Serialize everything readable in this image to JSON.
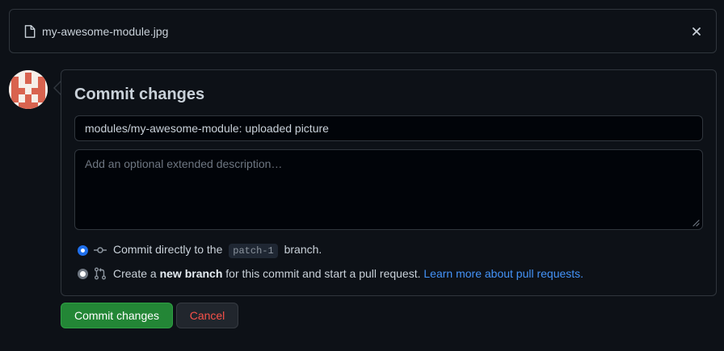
{
  "file": {
    "name": "my-awesome-module.jpg",
    "icon": "file-icon"
  },
  "commit": {
    "title": "Commit changes",
    "summary_value": "modules/my-awesome-module: uploaded picture",
    "description_placeholder": "Add an optional extended description…",
    "options": [
      {
        "icon": "git-commit-icon",
        "prefix": "Commit directly to the",
        "branch": "patch-1",
        "suffix": "branch.",
        "checked": true
      },
      {
        "icon": "git-pull-request-icon",
        "prefix": "Create a",
        "bold": "new branch",
        "suffix": "for this commit and start a pull request.",
        "link": "Learn more about pull requests.",
        "checked": false
      }
    ]
  },
  "buttons": {
    "commit_label": "Commit changes",
    "cancel_label": "Cancel"
  },
  "colors": {
    "background": "#0d1117",
    "border": "#30363d",
    "primary_green": "#238636",
    "danger_red": "#f85149",
    "link_blue": "#4493f8",
    "radio_blue": "#1f6feb"
  }
}
